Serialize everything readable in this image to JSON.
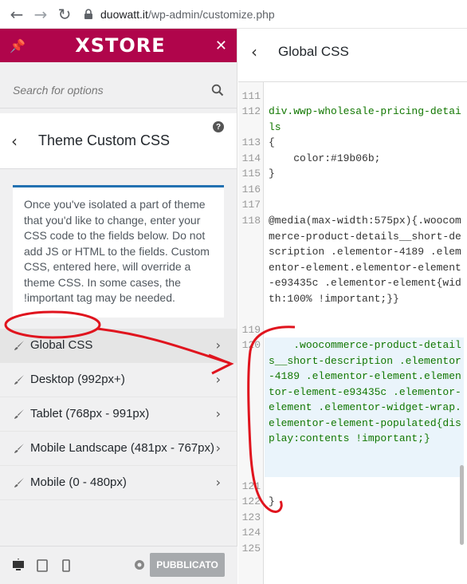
{
  "browser": {
    "url_host": "duowatt.it",
    "url_path": "/wp-admin/customize.php"
  },
  "sidebar": {
    "brand": "XSTORE",
    "search_placeholder": "Search for options",
    "section_title": "Theme Custom CSS",
    "description": "Once you've isolated a part of theme that you'd like to change, enter your CSS code to the fields below. Do not add JS or HTML to the fields. Custom CSS, entered here, will override a theme CSS. In some cases, the !important tag may be needed.",
    "items": [
      {
        "label": "Global CSS"
      },
      {
        "label": "Desktop (992px+)"
      },
      {
        "label": "Tablet (768px - 991px)"
      },
      {
        "label": "Mobile Landscape (481px - 767px)"
      },
      {
        "label": "Mobile (0 - 480px)"
      }
    ],
    "publish_label": "PUBBLICATO"
  },
  "panel": {
    "title": "Global CSS",
    "lines": [
      {
        "num": "111",
        "text": ""
      },
      {
        "num": "112",
        "text": "div.wwp-wholesale-pricing-details"
      },
      {
        "num": "113",
        "text": "{"
      },
      {
        "num": "114",
        "text": "    color:#19b06b;"
      },
      {
        "num": "115",
        "text": "}"
      },
      {
        "num": "116",
        "text": ""
      },
      {
        "num": "117",
        "text": ""
      },
      {
        "num": "118",
        "text": "@media(max-width:575px){.woocommerce-product-details__short-description .elementor-4189 .elementor-element.elementor-element-e93435c .elementor-element{width:100% !important;}}"
      },
      {
        "num": "119",
        "text": ""
      },
      {
        "num": "120",
        "text": "    .woocommerce-product-details__short-description .elementor-4189 .elementor-element.elementor-element-e93435c .elementor-element .elementor-widget-wrap.elementor-element-populated{display:contents !important;}"
      },
      {
        "num": "121",
        "text": ""
      },
      {
        "num": "122",
        "text": "}"
      },
      {
        "num": "123",
        "text": ""
      },
      {
        "num": "124",
        "text": ""
      },
      {
        "num": "125",
        "text": ""
      }
    ]
  },
  "colors": {
    "brand": "#b0054b",
    "annotation": "#e0141e"
  }
}
